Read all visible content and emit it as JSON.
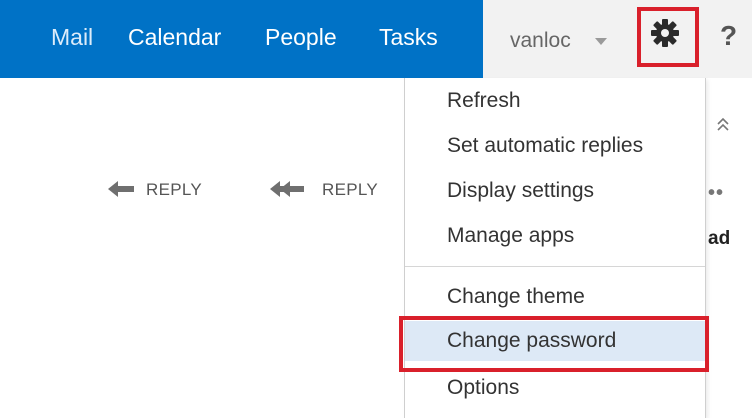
{
  "nav": {
    "items": [
      {
        "label": "Mail"
      },
      {
        "label": "Calendar"
      },
      {
        "label": "People"
      },
      {
        "label": "Tasks"
      }
    ]
  },
  "user": {
    "name": "vanloc"
  },
  "header_icons": {
    "settings": "gear-icon",
    "help": "?"
  },
  "toolbar": {
    "reply_label": "REPLY",
    "reply_all_label": "REPLY",
    "more": "••",
    "read_text": "ad"
  },
  "settings_menu": {
    "group1": [
      "Refresh",
      "Set automatic replies",
      "Display settings",
      "Manage apps"
    ],
    "group2": [
      "Change theme",
      "Change password",
      "Options"
    ],
    "selected": "Change password"
  },
  "colors": {
    "nav_bar": "#0072c6",
    "highlight_border": "#d9202b",
    "selected_item": "#dde9f6"
  }
}
